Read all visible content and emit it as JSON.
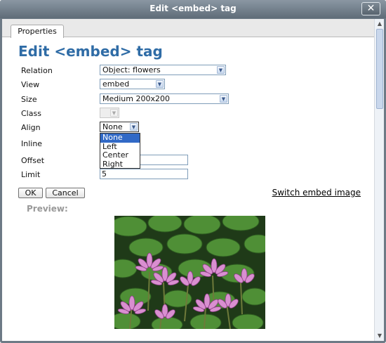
{
  "window": {
    "title": "Edit <embed> tag",
    "close_label": "✕"
  },
  "tabs": [
    {
      "label": "Properties"
    }
  ],
  "heading": "Edit <embed> tag",
  "form": {
    "relation": {
      "label": "Relation",
      "value": "Object: flowers"
    },
    "view": {
      "label": "View",
      "value": "embed"
    },
    "size": {
      "label": "Size",
      "value": "Medium 200x200"
    },
    "class": {
      "label": "Class",
      "value": ""
    },
    "align": {
      "label": "Align",
      "value": "None",
      "options": [
        "None",
        "Left",
        "Center",
        "Right"
      ]
    },
    "inline": {
      "label": "Inline"
    },
    "offset": {
      "label": "Offset",
      "value": ""
    },
    "limit": {
      "label": "Limit",
      "value": "5"
    }
  },
  "buttons": {
    "ok": "OK",
    "cancel": "Cancel"
  },
  "switch_link": "Switch embed image",
  "preview_label": "Preview:",
  "icons": {
    "select_arrow": "chevron-down-icon",
    "close": "close-icon"
  },
  "colors": {
    "heading": "#2f6ca6",
    "titlebar": "#6d7a86",
    "selected_option": "#3169c6"
  }
}
